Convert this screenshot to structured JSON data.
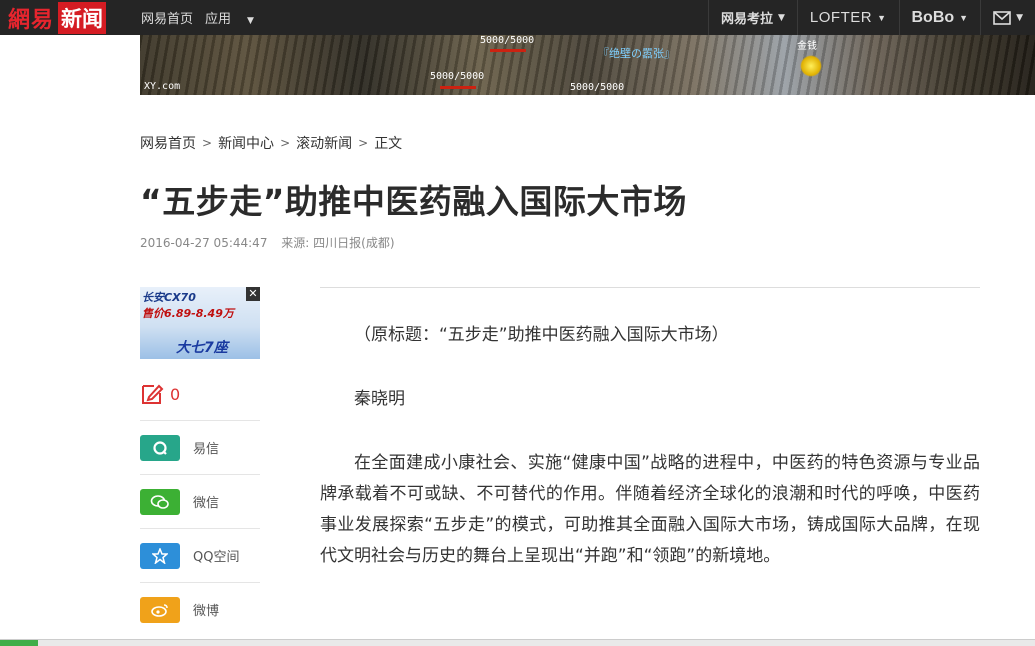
{
  "header": {
    "logo_brand": "網易",
    "logo_news": "新闻",
    "nav_left": [
      {
        "label": "网易首页"
      },
      {
        "label": "应用"
      }
    ],
    "nav_right": [
      {
        "label": "网易考拉"
      },
      {
        "label": "LOFTER"
      },
      {
        "label": "BoBo"
      },
      {
        "label": ""
      }
    ]
  },
  "banner": {
    "hp_labels": [
      "5000/5000",
      "5000/5000",
      "5000/5000"
    ],
    "name_label": "『绝壁の嚣张』",
    "gold_label": "金钱",
    "site_label": "XY.com"
  },
  "breadcrumb": [
    "网易首页",
    "新闻中心",
    "滚动新闻",
    "正文"
  ],
  "article": {
    "title": "“五步走”助推中医药融入国际大市场",
    "time": "2016-04-27 05:44:47",
    "source": "来源: 四川日报(成都)",
    "paragraphs": [
      "（原标题：“五步走”助推中医药融入国际大市场）",
      "秦晓明",
      "在全面建成小康社会、实施“健康中国”战略的进程中，中医药的特色资源与专业品牌承载着不可或缺、不可替代的作用。伴随着经济全球化的浪潮和时代的呼唤，中医药事业发展探索“五步走”的模式，可助推其全面融入国际大市场，铸成国际大品牌，在现代文明社会与历史的舞台上呈现出“并跑”和“领跑”的新境地。"
    ]
  },
  "ad": {
    "line1": "长安CX70",
    "line2": "售价6.89-8.49万",
    "line3": "大七7座",
    "close": "✕"
  },
  "comment_count": "0",
  "share": [
    {
      "label": "易信",
      "color": "#27a68a",
      "icon": "yixin-icon"
    },
    {
      "label": "微信",
      "color": "#3cb034",
      "icon": "wechat-icon"
    },
    {
      "label": "QQ空间",
      "color": "#2d8fd9",
      "icon": "qzone-icon"
    },
    {
      "label": "微博",
      "color": "#f0a21a",
      "icon": "weibo-icon"
    }
  ],
  "colors": {
    "topbar": "#252525",
    "brand_red": "#d51c23"
  }
}
